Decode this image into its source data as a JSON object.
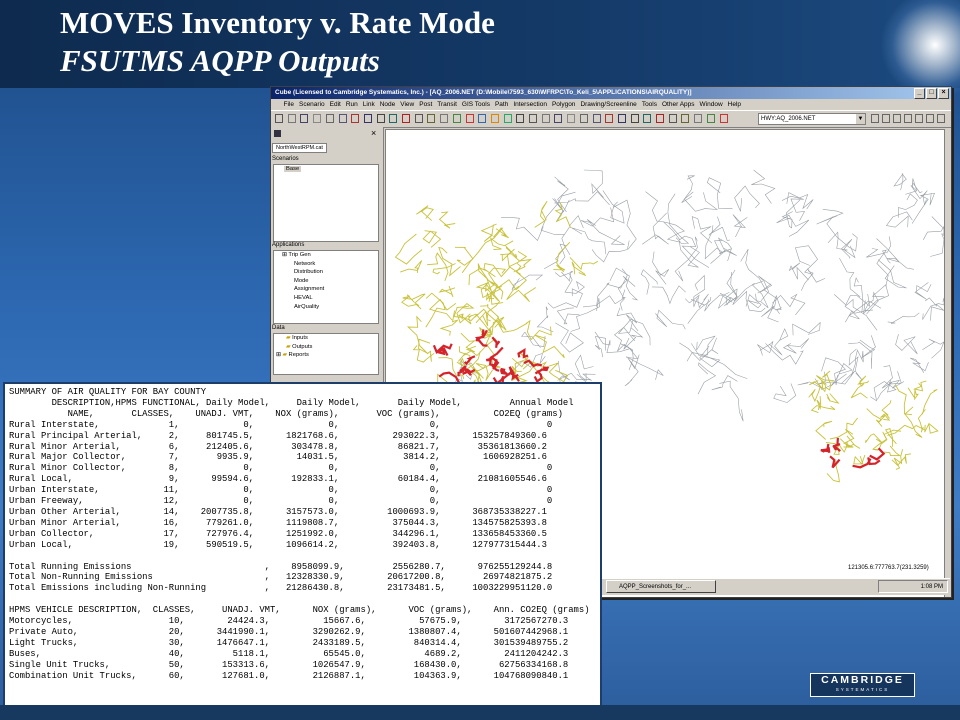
{
  "slide": {
    "title_line1": "MOVES Inventory v. Rate Mode",
    "title_line2": "FSUTMS AQPP Outputs"
  },
  "window": {
    "title": "Cube (Licensed to Cambridge Systematics, Inc.) - [AQ_2006.NET (D:\\Mobile\\7593_630\\WFRPC\\To_Keli_5\\APPLICATIONS\\AIRQUALITY)]",
    "menu": [
      "File",
      "Scenario",
      "Edit",
      "Run",
      "Link",
      "Node",
      "View",
      "Post",
      "Transit",
      "GIS Tools",
      "Path",
      "Intersection",
      "Polygon",
      "Drawing/Screenline",
      "Tools",
      "Other Apps",
      "Window",
      "Help"
    ],
    "layer_combo": "HWY:AQ_2006.NET",
    "controls": [
      "_",
      "□",
      "×"
    ]
  },
  "left_panel": {
    "catalog_tab": "NorthWestRPM.cat",
    "scenarios_header": "Scenarios",
    "scenarios": [
      "Base"
    ],
    "applications_header": "Applications",
    "applications": [
      "Trip Gen",
      "Network",
      "Distribution",
      "Mode",
      "Assignment",
      "HEVAL",
      "AirQuality"
    ],
    "data_header": "Data",
    "data_items": [
      "Inputs",
      "Outputs",
      "Reports"
    ]
  },
  "status": {
    "coords": "121305.6:777763.7(231.3259)"
  },
  "taskbar": {
    "task": "AQPP_Screenshots_for_...",
    "clock": "1:08 PM"
  },
  "report": {
    "title": "SUMMARY OF AIR QUALITY FOR BAY COUNTY",
    "hdr1": "        DESCRIPTION,HPMS FUNCTIONAL, Daily Model,     Daily Model,       Daily Model,         Annual Model",
    "hdr2": "           NAME,       CLASSES,    UNADJ. VMT,    NOX (grams),       VOC (grams),          CO2EQ (grams)",
    "rows": [
      "Rural Interstate,             1,            0,              0,                 0,                    0",
      "Rural Principal Arterial,     2,     801745.5,      1821768.6,          293022.3,      153257849360.6",
      "Rural Minor Arterial,         6,     212405.6,       303478.8,           86821.7,       35361813660.2",
      "Rural Major Collector,        7,       9935.9,        14031.5,            3814.2,        1606928251.6",
      "Rural Minor Collector,        8,            0,              0,                 0,                    0",
      "Rural Local,                  9,      99594.6,       192833.1,           60184.4,       21081605546.6",
      "Urban Interstate,            11,            0,              0,                 0,                    0",
      "Urban Freeway,               12,            0,              0,                 0,                    0",
      "Urban Other Arterial,        14,    2007735.8,      3157573.0,         1000693.9,      368735338227.1",
      "Urban Minor Arterial,        16,     779261.0,      1119808.7,          375044.3,      134575825393.8",
      "Urban Collector,             17,     727976.4,      1251992.0,          344296.1,      133658453360.5",
      "Urban Local,                 19,     590519.5,      1096614.2,          392403.8,      127977315444.3"
    ],
    "totals": [
      "Total Running Emissions                         ,    8958099.9,         2556280.7,      976255129244.8",
      "Total Non-Running Emissions                     ,   12328330.9,        20617200.8,       26974821875.2",
      "Total Emissions including Non-Running           ,   21286430.8,        23173481.5,     1003229951120.0"
    ],
    "veh_header": "HPMS VEHICLE DESCRIPTION,  CLASSES,     UNADJ. VMT,      NOX (grams),      VOC (grams),    Ann. CO2EQ (grams)",
    "veh_rows": [
      "Motorcycles,                  10,        24424.3,          15667.6,          57675.9,        3172567270.3",
      "Private Auto,                 20,      3441990.1,        3290262.9,        1380807.4,      501607442968.1",
      "Light Trucks,                 30,      1476647.1,        2433189.5,         840314.4,      301539489755.2",
      "Buses,                        40,         5118.1,          65545.0,           4689.2,        2411204242.3",
      "Single Unit Trucks,           50,       153313.6,        1026547.9,         168430.0,       62756334168.8",
      "Combination Unit Trucks,      60,       127681.0,        2126887.1,         104363.9,      104768090840.1"
    ]
  },
  "logo": {
    "main": "CAMBRIDGE",
    "sub": "SYSTEMATICS"
  },
  "colors": {
    "map_network": "#9aa0a6",
    "map_highway": "#c8c23a",
    "map_congested": "#d4232a",
    "title_bar": "#0a246a"
  }
}
